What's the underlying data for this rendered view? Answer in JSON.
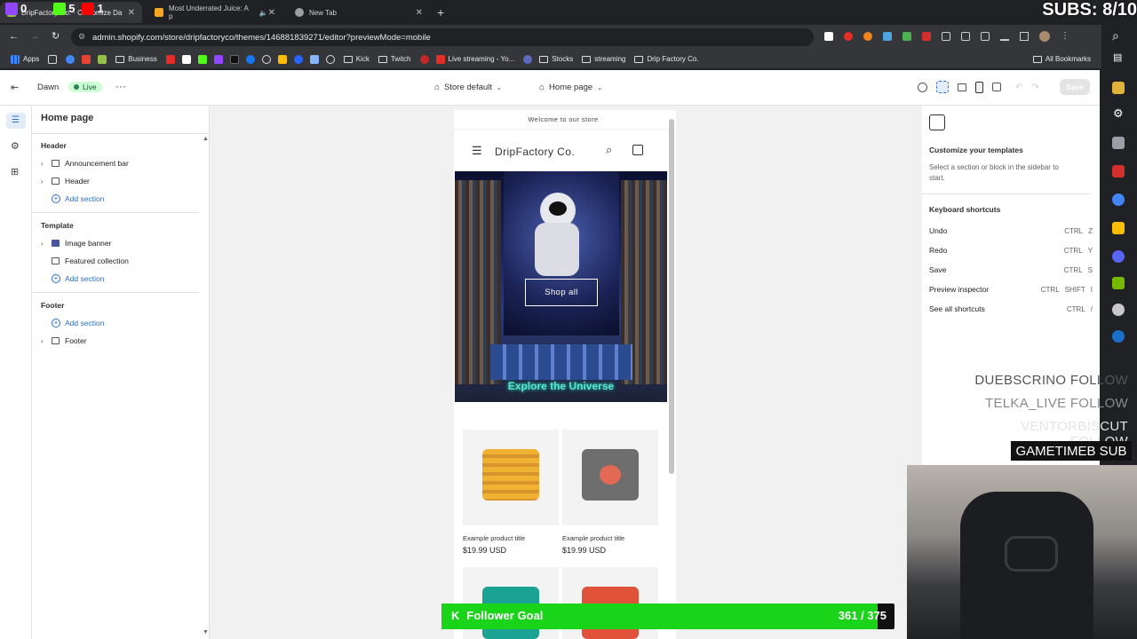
{
  "browser": {
    "tabs": [
      {
        "label": "DripFactory Co. · Customize Da",
        "color": "#95bf47"
      },
      {
        "label": "Most Underrated Juice: A p",
        "color": "#f5a623"
      },
      {
        "label": "New Tab",
        "color": "#9aa0a6"
      }
    ],
    "stream_counts": [
      "0",
      "5",
      "1"
    ],
    "url": "admin.shopify.com/store/dripfactoryco/themes/146881839271/editor?previewMode=mobile",
    "bookmarks": [
      "Apps",
      "Business",
      "Kick",
      "Twitch",
      "Live streaming - Yo...",
      "Stocks",
      "streaming",
      "Drip Factory Co."
    ],
    "all_bookmarks": "All Bookmarks"
  },
  "editor": {
    "theme_name": "Dawn",
    "live_badge": "Live",
    "more": "···",
    "store_select": "Store default",
    "page_select": "Home page",
    "save_label": "Save"
  },
  "sidebar": {
    "title": "Home page",
    "groups": [
      {
        "heading": "Header",
        "items": [
          "Announcement bar",
          "Header"
        ],
        "add": "Add section"
      },
      {
        "heading": "Template",
        "items": [
          "Image banner",
          "Featured collection"
        ],
        "add": "Add section"
      },
      {
        "heading": "Footer",
        "items": [
          "Footer"
        ],
        "add": "Add section"
      }
    ]
  },
  "preview": {
    "announcement": "Welcome to our store",
    "store_name": "DripFactory Co.",
    "button_label": "Shop all",
    "banner_caption": "Explore the Universe",
    "products": [
      {
        "title": "Example product title",
        "price": "$19.99 USD",
        "color": "#f0b233"
      },
      {
        "title": "Example product title",
        "price": "$19.99 USD",
        "color": "#6e6e6e"
      }
    ]
  },
  "right_panel": {
    "heading": "Customize your templates",
    "description": "Select a section or block in the sidebar to start.",
    "shortcuts_heading": "Keyboard shortcuts",
    "shortcuts": [
      {
        "label": "Undo",
        "keys": [
          "CTRL",
          "Z"
        ]
      },
      {
        "label": "Redo",
        "keys": [
          "CTRL",
          "Y"
        ]
      },
      {
        "label": "Save",
        "keys": [
          "CTRL",
          "S"
        ]
      },
      {
        "label": "Preview inspector",
        "keys": [
          "CTRL",
          "SHIFT",
          "I"
        ]
      },
      {
        "label": "See all shortcuts",
        "keys": [
          "CTRL",
          "/"
        ]
      }
    ]
  },
  "overlay": {
    "subs": "SUBS: 8/10",
    "follows": [
      "DUEBSCRINO FOLLOW",
      "TELKA_LIVE FOLLOW",
      "VENTORBISCUT FOLLOW"
    ],
    "sub_alert": "GAMETIMEB SUB",
    "goal_label": "Follower Goal",
    "goal_count": "361 / 375",
    "goal_progress": 0.963
  }
}
